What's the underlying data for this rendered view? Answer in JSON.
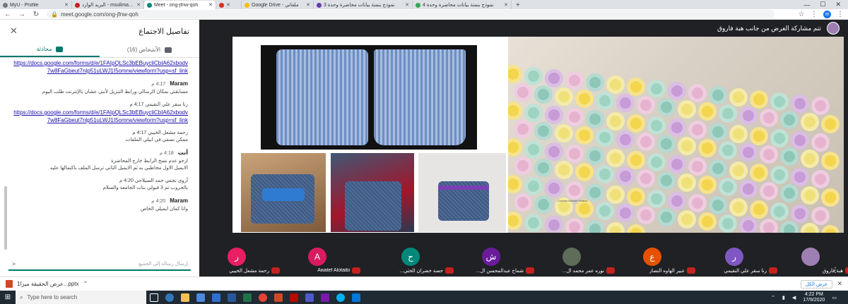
{
  "browser": {
    "tabs": [
      {
        "label": "MyU - Profile",
        "active": false
      },
      {
        "label": "البريد الوارد - msuliman@su.edu.sa",
        "active": false
      },
      {
        "label": "Meet - ong-jfnw-qoh",
        "active": true
      },
      {
        "label": "",
        "active": false
      },
      {
        "label": "Google Drive - ملفاتي",
        "active": false
      },
      {
        "label": "نموذج بنمنة بيانات محاضرة وحدة 3",
        "active": false
      },
      {
        "label": "نموذج بنمنة بيانات محاضرة وحدة 4",
        "active": false
      }
    ],
    "new_tab": "+",
    "url": "meet.google.com/ong-jfnw-qoh",
    "profile_initial": "m"
  },
  "panel": {
    "title": "تفاصيل الاجتماع",
    "tab_people": "الأشخاص (16)",
    "tab_chat": "محادثة",
    "messages": [
      {
        "link": "https://docs.google.com/forms/d/e/1FAIpQLSc3bEBuycliCbIA62xbodv7w8FaGbeut7nlp51uLWJ1I5omrw/viewform?usp=sf_link"
      },
      {
        "name": "Maram",
        "time": "4:17 م",
        "text": "مسابقتي بمكان الرسالي ورابط التنزيل لأنني عشان بالإنترنت طلب اليوم"
      },
      {
        "text": "رنا سقر علي النقيمي 4:17 م",
        "link": "https://docs.google.com/forms/d/e/1FAIpQLSc3bEBuycliCbIA62xbodv7w8FaGbeut7nlp51uLWJ1I5omrw/viewform?usp=sf_link"
      },
      {
        "text": "رحمة مشعل الخيبي 4:17 م",
        "text2": "ممكن نصفي في ابيلي الملفات"
      },
      {
        "name": "أنت",
        "time": "4:18 م",
        "text": "ارجو عدم نسخ الرابط خارج المحاضرة",
        "text2": "الايميل الاول مخاطبي به ثم الايميل الثاني ترسل الملف باكتمالها عليه"
      },
      {
        "text": "أروى نجمي حمد السيلاجي 4:20 م",
        "text2": "بالجروب تم 3 قبولي بنات الجامعة والسلام"
      },
      {
        "name": "Maram",
        "time": "4:20 م",
        "text": "وانا كمان ايميلي الخاص"
      }
    ],
    "compose_placeholder": "إرسال رسالة إلى الجميع"
  },
  "stage": {
    "presenter_title": "تتم مشاركة العرض من جانب هبة فاروق",
    "slide_caption": "Crochet Blanket Pattern"
  },
  "participants": [
    {
      "name": "هبة فاروق",
      "initial": "",
      "color": "#9e7fb4"
    },
    {
      "name": "رنا سقر علي النقيمي",
      "initial": "ر",
      "color": "#7e57c2"
    },
    {
      "name": "عبير الهاوه النصار",
      "initial": "ع",
      "color": "#e65100"
    },
    {
      "name": "نوره عمر محمد ال...",
      "initial": "",
      "color": "#5d6d5a"
    },
    {
      "name": "شماخ عبدالمحسن ال...",
      "initial": "ش",
      "color": "#6a1b9a"
    },
    {
      "name": "حصة خضران الخثي...",
      "initial": "ح",
      "color": "#00897b"
    },
    {
      "name": "Awatef Alotaibi",
      "initial": "A",
      "color": "#d81b60"
    },
    {
      "name": "رحمة مشعل الخيبي",
      "initial": "ر",
      "color": "#e91e63"
    }
  ],
  "downloads": {
    "file": "عرض الحقيقة ميزا1...pptx",
    "show_all": "عرض الكل"
  },
  "taskbar": {
    "search": "Type here to search",
    "time": "4:22 PM",
    "date": "17/9/2020"
  },
  "colors": {
    "accent": "#00796b",
    "mic_off": "#c5221f"
  }
}
